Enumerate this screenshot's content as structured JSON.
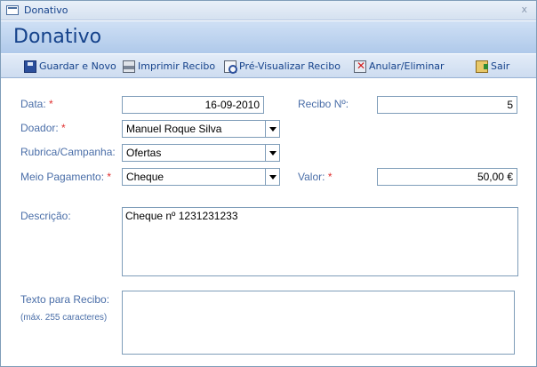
{
  "window": {
    "title": "Donativo",
    "close_glyph": "x"
  },
  "header": {
    "title": "Donativo"
  },
  "toolbar": {
    "save": {
      "label": "Guardar e Novo",
      "icon": "save-icon"
    },
    "print": {
      "label": "Imprimir Recibo",
      "icon": "printer-icon"
    },
    "preview": {
      "label": "Pré-Visualizar Recibo",
      "icon": "print-preview-icon"
    },
    "delete": {
      "label": "Anular/Eliminar",
      "icon": "delete-icon"
    },
    "exit": {
      "label": "Sair",
      "icon": "exit-icon"
    }
  },
  "form": {
    "data": {
      "label": "Data:",
      "required": "*",
      "value": "16-09-2010"
    },
    "recibo": {
      "label": "Recibo Nº:",
      "value": "5"
    },
    "doador": {
      "label": "Doador:",
      "required": "*",
      "value": "Manuel Roque Silva"
    },
    "rubrica": {
      "label": "Rubrica/Campanha:",
      "value": "Ofertas"
    },
    "meio": {
      "label": "Meio Pagamento:",
      "required": "*",
      "value": "Cheque"
    },
    "valor": {
      "label": "Valor:",
      "required": "*",
      "value": "50,00 €"
    },
    "descricao": {
      "label": "Descrição:",
      "value": "Cheque nº 1231231233"
    },
    "texto_recibo": {
      "label": "Texto para Recibo:",
      "hint": "(máx. 255 caracteres)",
      "value": ""
    }
  },
  "colors": {
    "label": "#4a6ea8",
    "required": "#e0302f",
    "accent": "#15428b"
  }
}
